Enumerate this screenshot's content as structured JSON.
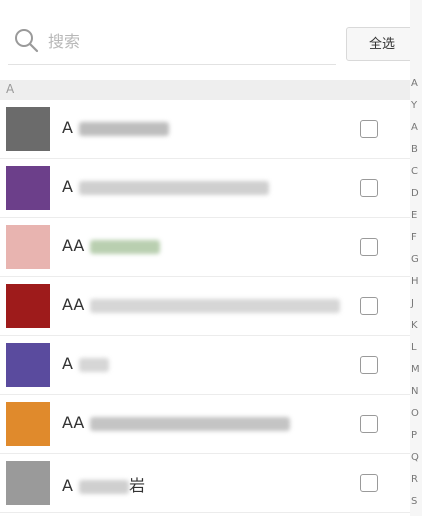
{
  "search": {
    "placeholder": "搜索",
    "icon": "search-icon"
  },
  "select_all_label": "全选",
  "section_header": "A",
  "contacts": [
    {
      "name": "A",
      "avatar_color": "#6b6b6b"
    },
    {
      "name": "A",
      "avatar_color": "#6c3f8a"
    },
    {
      "name": "AA",
      "avatar_color": "#e8b4b0"
    },
    {
      "name": "AA",
      "avatar_color": "#9e1b1b"
    },
    {
      "name": "A",
      "avatar_color": "#5a4b9e"
    },
    {
      "name": "AA",
      "avatar_color": "#e08a2c"
    },
    {
      "name": "A",
      "name_suffix": "岩",
      "avatar_color": "#9a9a9a"
    }
  ],
  "index_letters": [
    "A",
    "Y",
    "A",
    "B",
    "C",
    "D",
    "E",
    "F",
    "G",
    "H",
    "J",
    "K",
    "L",
    "M",
    "N",
    "O",
    "P",
    "Q",
    "R",
    "S"
  ]
}
